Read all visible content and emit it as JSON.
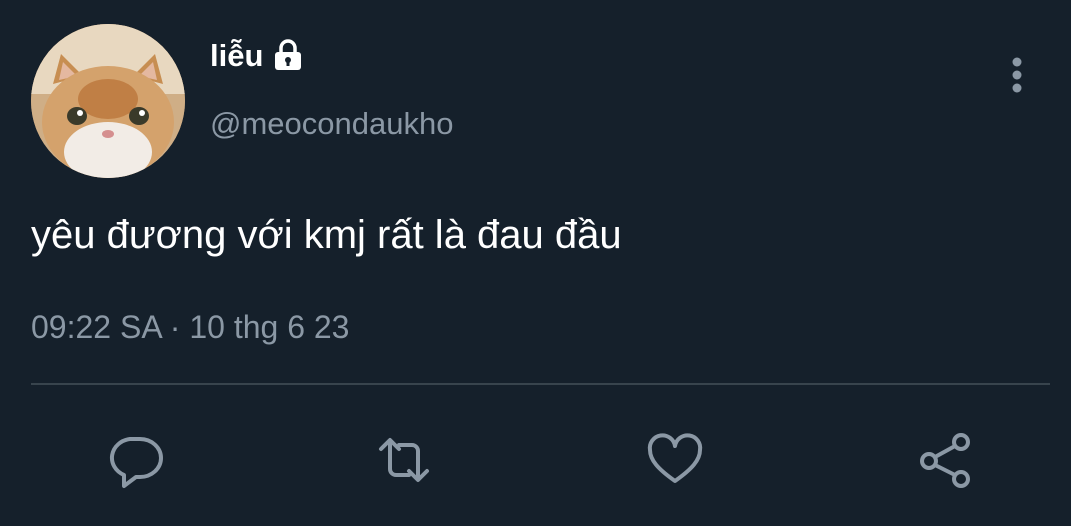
{
  "author": {
    "display_name": "liễu",
    "handle": "@meocondaukho",
    "protected_icon": "lock-icon",
    "avatar_icon": "cat-avatar"
  },
  "tweet": {
    "text": "yêu đương với kmj rất là đau đầu",
    "time": "09:22 SA",
    "separator": "·",
    "date": "10 thg 6 23"
  },
  "actions": [
    {
      "icon": "reply-icon"
    },
    {
      "icon": "retweet-icon"
    },
    {
      "icon": "like-icon"
    },
    {
      "icon": "share-icon"
    }
  ],
  "colors": {
    "background": "#15202b",
    "text_primary": "#ffffff",
    "text_secondary": "#8b98a5",
    "divider": "#38444d",
    "icon": "#8b98a5"
  }
}
